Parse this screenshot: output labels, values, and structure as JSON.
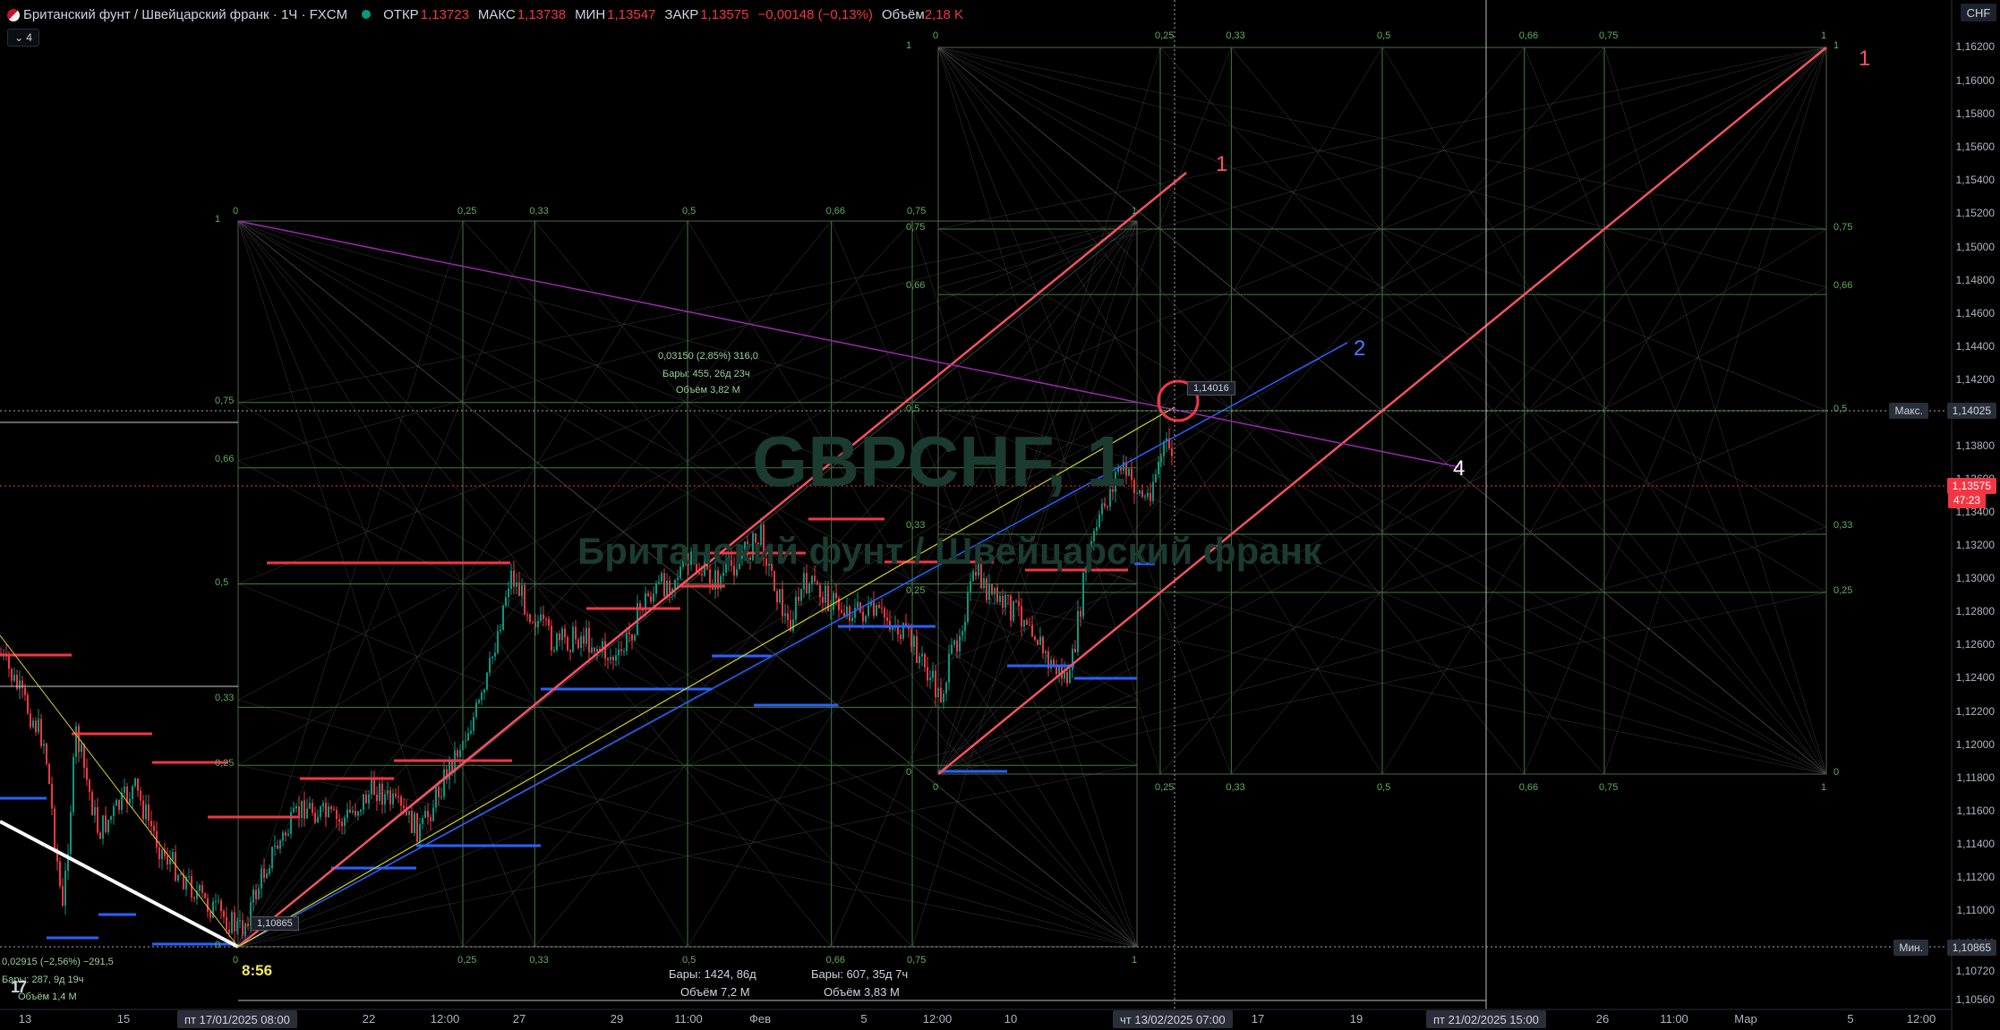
{
  "header": {
    "title": "Британский фунт / Швейцарский франк · 1Ч · FXCM",
    "open_label": "ОТКР",
    "open": "1,13723",
    "high_label": "МАКС",
    "high": "1,13738",
    "low_label": "МИН",
    "low": "1,13547",
    "close_label": "ЗАКР",
    "close": "1,13575",
    "change": "−0,00148 (−0,13%)",
    "volume_label": "Объём",
    "volume": "2,18 K",
    "indicator_count": "4"
  },
  "watermark": {
    "symbol": "GBPCHF, 1",
    "name": "Британский фунт / Швейцарский франк"
  },
  "price_axis": {
    "currency": "CHF",
    "ticks": [
      "1,16200",
      "1,16000",
      "1,15800",
      "1,15600",
      "1,15400",
      "1,15200",
      "1,15000",
      "1,14800",
      "1,14600",
      "1,14400",
      "1,14200",
      "1,14000",
      "1,13800",
      "1,13600",
      "1,13400",
      "1,13200",
      "1,13000",
      "1,12800",
      "1,12600",
      "1,12400",
      "1,12200",
      "1,12000",
      "1,11800",
      "1,11600",
      "1,11400",
      "1,11200",
      "1,11000",
      "1,10800",
      "1,10720",
      "1,10560"
    ],
    "max_label": "Макс.",
    "max_value": "1,14025",
    "current_value": "1,13575",
    "countdown": "47:23",
    "min_label": "Мин.",
    "min_value": "1,10865"
  },
  "time_axis": {
    "labels": [
      "13",
      "15",
      "22",
      "12:00",
      "27",
      "29",
      "11:00",
      "Фев",
      "5",
      "12:00",
      "10",
      "17",
      "19",
      "26",
      "11:00",
      "Мар",
      "5",
      "12:00"
    ],
    "tag_start": "пт 17/01/2025   08:00",
    "tag_cursor": "чт 13/02/2025   07:00",
    "tag_end": "пт 21/02/2025   15:00"
  },
  "annotations": {
    "range_measure": [
      "0,03150 (2,85%) 316,0",
      "Бары: 455, 26д 23ч",
      "Объём 3,82 M"
    ],
    "bottom_left_measure": [
      "0,02915 (−2,56%) −291,5",
      "Бары: 287, 9д 19ч",
      "Объём 1,4 M"
    ],
    "bars_total": "Бары: 1424, 86д",
    "vol_total": "Объём 7,2 M",
    "bars_second": "Бары: 607, 35д 7ч",
    "vol_second": "Объём 3,83 M",
    "time_mark": "8:56",
    "low_tag": "1,10865",
    "high_tag": "1,14016",
    "marker_1a": "1",
    "marker_1b": "1",
    "marker_2": "2",
    "marker_4": "4"
  },
  "gann_box_left": {
    "top_labels": [
      "0",
      "0,25",
      "0,33",
      "0,5",
      "0,66",
      "0,75",
      "1"
    ],
    "side_labels": [
      "1",
      "0,75",
      "0,66",
      "0,5",
      "0,33",
      "0,25",
      "0"
    ]
  },
  "gann_box_right": {
    "top_labels": [
      "0",
      "0,25",
      "0,33",
      "0,5",
      "0,66",
      "0,75",
      "1"
    ],
    "side_labels": [
      "1",
      "0,75",
      "0,66",
      "0,5",
      "0,33",
      "0,25",
      "0"
    ]
  },
  "colors": {
    "up": "#089981",
    "down": "#f23645",
    "grid_green": "#3f7d3f",
    "fan_red": "#f7525f",
    "fan_blue": "#2962ff",
    "fan_yellow": "#d4d428",
    "fan_purple": "#9c27b0"
  }
}
